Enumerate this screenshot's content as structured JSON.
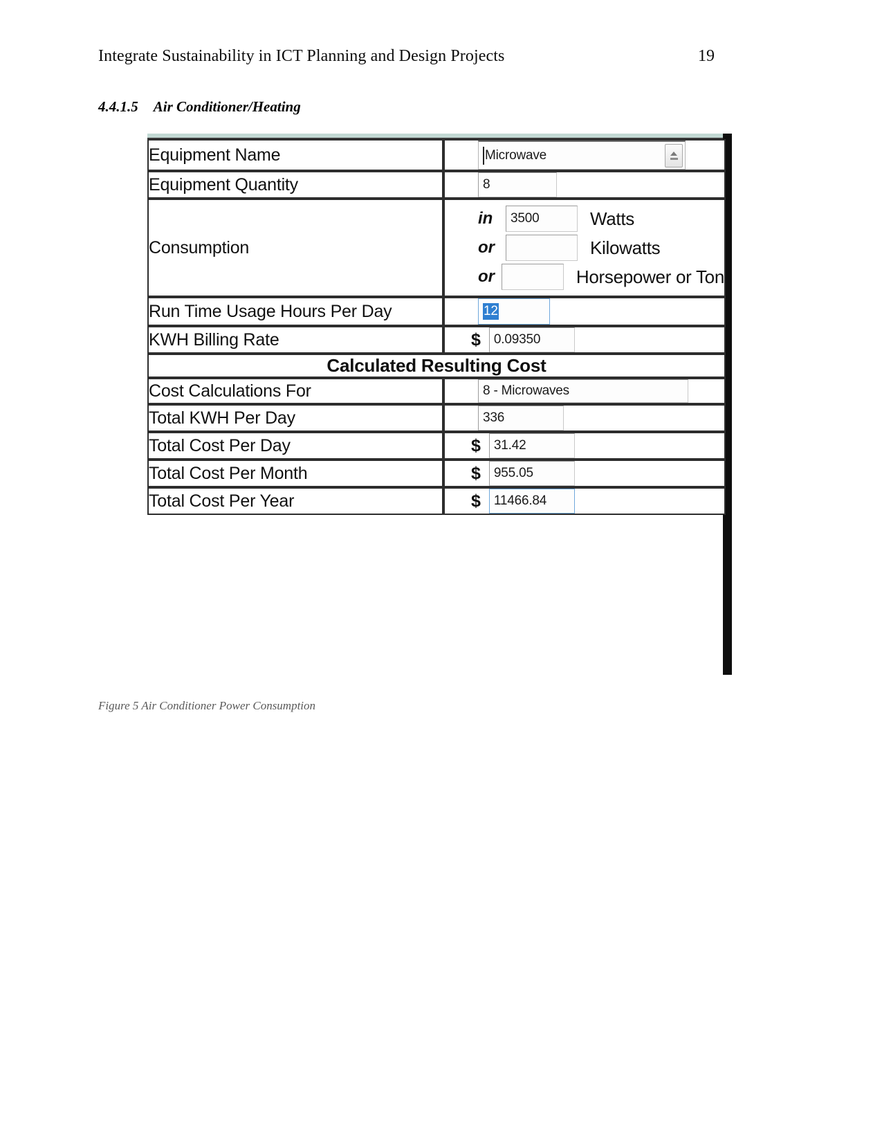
{
  "header": {
    "running_title": "Integrate Sustainability in ICT Planning and Design Projects",
    "page_number": "19"
  },
  "section": {
    "number": "4.4.1.5",
    "title": "Air Conditioner/Heating"
  },
  "figure": {
    "caption": "Figure 5 Air Conditioner Power Consumption",
    "accent_teal": "#bcd6d1",
    "selection_blue": "#2f7fd1",
    "focus_border": "#6fa8dc",
    "rows": [
      {
        "label": "Equipment Name",
        "value": "Microwave",
        "icon": "spinner-icon"
      },
      {
        "label": "Equipment Quantity",
        "value": "8"
      },
      {
        "label": "Consumption"
      },
      {
        "label": "Run Time Usage Hours Per Day",
        "value": "12"
      },
      {
        "label": "KWH Billing Rate",
        "value": "0.09350",
        "prefix": "$"
      },
      {
        "label": "Cost Calculations For",
        "value": "8 - Microwaves"
      },
      {
        "label": "Total KWH Per Day",
        "value": "336"
      },
      {
        "label": "Total Cost Per Day",
        "value": "31.42",
        "prefix": "$"
      },
      {
        "label": "Total Cost Per Month",
        "value": "955.05",
        "prefix": "$"
      },
      {
        "label": "Total Cost Per Year",
        "value": "11466.84",
        "prefix": "$"
      }
    ],
    "consumption": {
      "lines": [
        {
          "conj": "in",
          "value": "3500",
          "unit": "Watts"
        },
        {
          "conj": "or",
          "value": "",
          "unit": "Kilowatts"
        },
        {
          "conj": "or",
          "value": "",
          "unit": "Horsepower or Ton"
        }
      ]
    },
    "banner": "Calculated Resulting Cost"
  }
}
